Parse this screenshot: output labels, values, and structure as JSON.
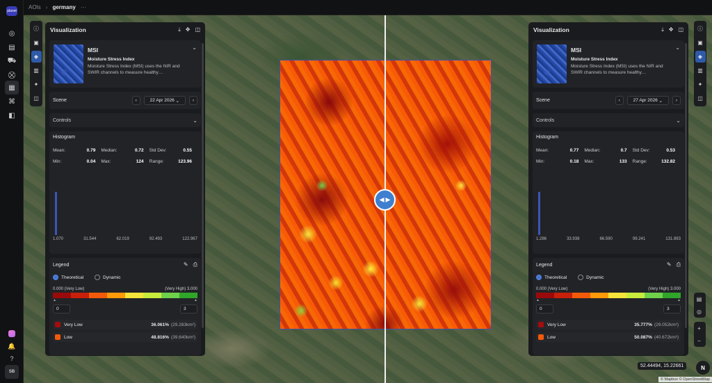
{
  "topbar": {
    "crumb_root": "AOIs",
    "crumb_current": "germany",
    "more": "···"
  },
  "leftnav": {
    "logo_text": "planet",
    "user_initials": "SB"
  },
  "split_handle": {
    "left_arrow": "◀",
    "right_arrow": "▶"
  },
  "panels": [
    {
      "title": "Visualization",
      "layer_name": "MSI",
      "layer_full": "Moisture Stress Index",
      "layer_desc": "Moisture Stress Index (MSI) uses the NIR and SWIR channels to measure healthy…",
      "scene_label": "Scene",
      "scene_date": "22 Apr 2026",
      "controls_label": "Controls",
      "histogram_label": "Histogram",
      "stats": [
        {
          "k": "Mean:",
          "v": "0.79"
        },
        {
          "k": "Median:",
          "v": "0.72"
        },
        {
          "k": "Std Dev:",
          "v": "0.55"
        },
        {
          "k": "Min:",
          "v": "0.04"
        },
        {
          "k": "Max:",
          "v": "124"
        },
        {
          "k": "Range:",
          "v": "123.96"
        }
      ],
      "hist_axis": [
        "1.070",
        "31.544",
        "62.019",
        "92.493",
        "122.967"
      ],
      "legend_label": "Legend",
      "mode_theoretical": "Theoretical",
      "mode_dynamic": "Dynamic",
      "range_low": "0.000 (Very Low)",
      "range_high": "(Very High) 3.000",
      "min_value": "0",
      "max_value": "3",
      "classes": [
        {
          "name": "Very Low",
          "pct": "36.061%",
          "area": "(29.283km²)",
          "color": "#a30d0d"
        },
        {
          "name": "Low",
          "pct": "48.816%",
          "area": "(39.640km²)",
          "color": "#f25a0a"
        }
      ]
    },
    {
      "title": "Visualization",
      "layer_name": "MSI",
      "layer_full": "Moisture Stress Index",
      "layer_desc": "Moisture Stress Index (MSI) uses the NIR and SWIR channels to measure healthy…",
      "scene_label": "Scene",
      "scene_date": "27 Apr 2026",
      "controls_label": "Controls",
      "histogram_label": "Histogram",
      "stats": [
        {
          "k": "Mean:",
          "v": "0.77"
        },
        {
          "k": "Median:",
          "v": "0.7"
        },
        {
          "k": "Std Dev:",
          "v": "0.53"
        },
        {
          "k": "Min:",
          "v": "0.18"
        },
        {
          "k": "Max:",
          "v": "133"
        },
        {
          "k": "Range:",
          "v": "132.82"
        }
      ],
      "hist_axis": [
        "1.286",
        "33.938",
        "66.590",
        "99.241",
        "131.893"
      ],
      "legend_label": "Legend",
      "mode_theoretical": "Theoretical",
      "mode_dynamic": "Dynamic",
      "range_low": "0.000 (Very Low)",
      "range_high": "(Very High) 3.000",
      "min_value": "0",
      "max_value": "3",
      "classes": [
        {
          "name": "Very Low",
          "pct": "35.777%",
          "area": "(29.052km²)",
          "color": "#a30d0d"
        },
        {
          "name": "Low",
          "pct": "50.087%",
          "area": "(40.672km²)",
          "color": "#f25a0a"
        }
      ]
    }
  ],
  "legend_colors": [
    "#9b0a0a",
    "#c8200a",
    "#f25a0a",
    "#ff9a0a",
    "#f5e43a",
    "#c8ec3c",
    "#6fd04a",
    "#2fa52a"
  ],
  "map": {
    "coords": "52.44494, 15.22661",
    "attribution": "© Mapbox © OpenStreetMap",
    "compass": "N"
  }
}
